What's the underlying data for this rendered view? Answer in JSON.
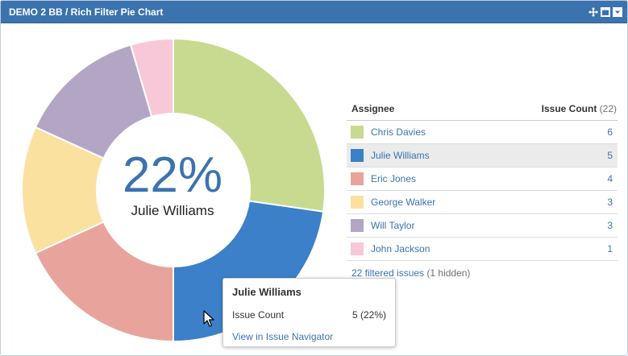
{
  "header": {
    "title": "DEMO 2 BB / Rich Filter Pie Chart",
    "icons": [
      "move-icon",
      "maximize-icon",
      "menu-dropdown-icon"
    ]
  },
  "center": {
    "percent": "22%",
    "name": "Julie Williams"
  },
  "legend": {
    "assignee_label": "Assignee",
    "count_label": "Issue Count",
    "total": "(22)",
    "filtered_text": "22 filtered issues",
    "hidden_text": "(1 hidden)"
  },
  "tooltip": {
    "title": "Julie Williams",
    "metric_label": "Issue Count",
    "metric_value": "5 (22%)",
    "link": "View in Issue Navigator"
  },
  "chart_data": {
    "type": "pie",
    "donut": true,
    "categories": [
      "Chris Davies",
      "Julie Williams",
      "Eric Jones",
      "George Walker",
      "Will Taylor",
      "John Jackson"
    ],
    "values": [
      6,
      5,
      4,
      3,
      3,
      1
    ],
    "colors": [
      "#c8da8f",
      "#3b80c8",
      "#e8a49c",
      "#fbe1a0",
      "#b3a6c5",
      "#f9c8d8"
    ],
    "highlighted": "Julie Williams",
    "legend": "right"
  }
}
